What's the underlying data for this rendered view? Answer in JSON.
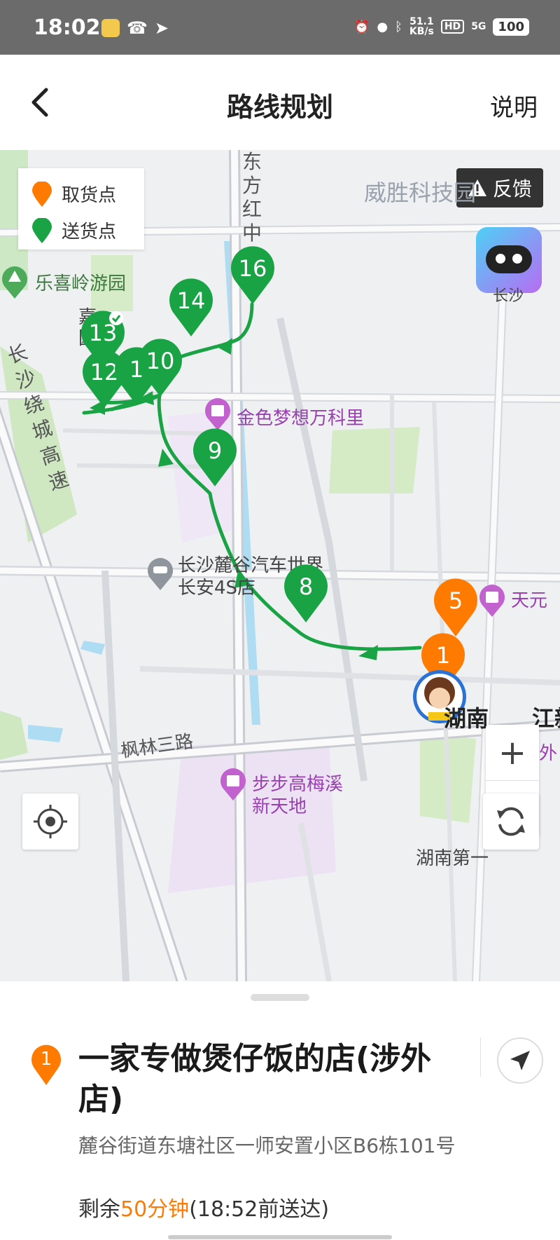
{
  "status_bar": {
    "time": "18:02",
    "net_speed_value": "51.1",
    "net_speed_unit": "KB/s",
    "hd_label": "HD",
    "network": "5G",
    "battery": "100"
  },
  "header": {
    "title": "路线规划",
    "help_label": "说明"
  },
  "legend": {
    "pickup_label": "取货点",
    "delivery_label": "送货点"
  },
  "colors": {
    "pickup": "#ff7a00",
    "delivery": "#1aa345",
    "route": "#1aa345",
    "poi_purple": "#c262cf"
  },
  "feedback_label": "反馈",
  "robot_label": "长沙",
  "map_labels": {
    "weisheng": "威胜科技园",
    "dongfang": "东方红中路",
    "lexiling": "乐喜岭游园",
    "jiaoyuan": "嘉园",
    "ring": "长沙绕城高速",
    "jinse": "金色梦想万科里",
    "lugu1": "长沙麓谷汽车世界",
    "lugu2": "长安4S店",
    "tianyuan": "天元",
    "fenglin": "枫林三路",
    "bubugao1": "步步高梅溪",
    "bubugao2": "新天地",
    "hunan1": "湖南第一",
    "hunan_cut": "湖南",
    "hunan_cut2": "江新",
    "shewai": "外"
  },
  "markers": {
    "m16": "16",
    "m14": "14",
    "m13": "13",
    "m12": "12",
    "m11": "1",
    "m10": "10",
    "m9": "9",
    "m8": "8",
    "m5": "5",
    "m1": "1"
  },
  "order": {
    "index": "1",
    "shop_name": "一家专做煲仔饭的店(涉外店)",
    "address": "麓谷街道东塘社区一师安置小区B6栋101号",
    "remain_prefix": "剩余",
    "remain_time": "50分钟",
    "remain_suffix": "(18:52前送达)"
  }
}
